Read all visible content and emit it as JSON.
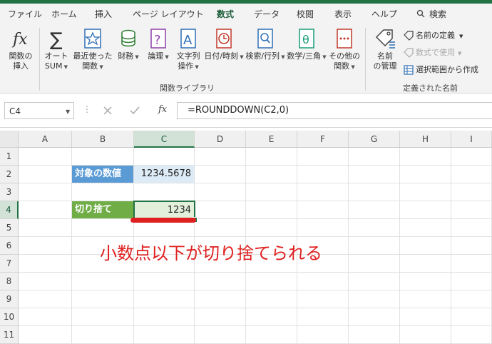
{
  "tabs": [
    "ファイル",
    "ホーム",
    "挿入",
    "ページ レイアウト",
    "数式",
    "データ",
    "校閲",
    "表示",
    "ヘルプ"
  ],
  "search_label": "検索",
  "ribbon": {
    "insert_function": [
      "関数の",
      "挿入"
    ],
    "autosum": [
      "オート",
      "SUM"
    ],
    "recent": [
      "最近使った",
      "関数"
    ],
    "financial": "財務",
    "logical": "論理",
    "text": [
      "文字列",
      "操作"
    ],
    "datetime": "日付/時刻",
    "lookup": "検索/行列",
    "math": "数学/三角",
    "more": [
      "その他の",
      "関数"
    ],
    "name_manager": [
      "名前",
      "の管理"
    ],
    "define_name": "名前の定義",
    "use_in_formula": "数式で使用",
    "create_from_selection": "選択範囲から作成",
    "group_library": "関数ライブラリ",
    "group_names": "定義された名前"
  },
  "formula_bar": {
    "name_box": "C4",
    "fx": "fx",
    "formula": "=ROUNDDOWN(C2,0)"
  },
  "columns": [
    "A",
    "B",
    "C",
    "D",
    "E",
    "F",
    "G",
    "H",
    "I"
  ],
  "rows": [
    "1",
    "2",
    "3",
    "4",
    "5",
    "6",
    "7",
    "8",
    "9",
    "10",
    "11"
  ],
  "cells": {
    "B2": "対象の数値",
    "C2": "1234.5678",
    "B4": "切り捨て",
    "C4": "1234"
  },
  "annotation": "小数点以下が切り捨てられる",
  "colors": {
    "accent": "#217346",
    "label_blue": "#5b9bd5",
    "value_blue": "#ddebf7",
    "label_green": "#70ad47",
    "value_green": "#e2efda",
    "annotation_red": "#e02020"
  }
}
